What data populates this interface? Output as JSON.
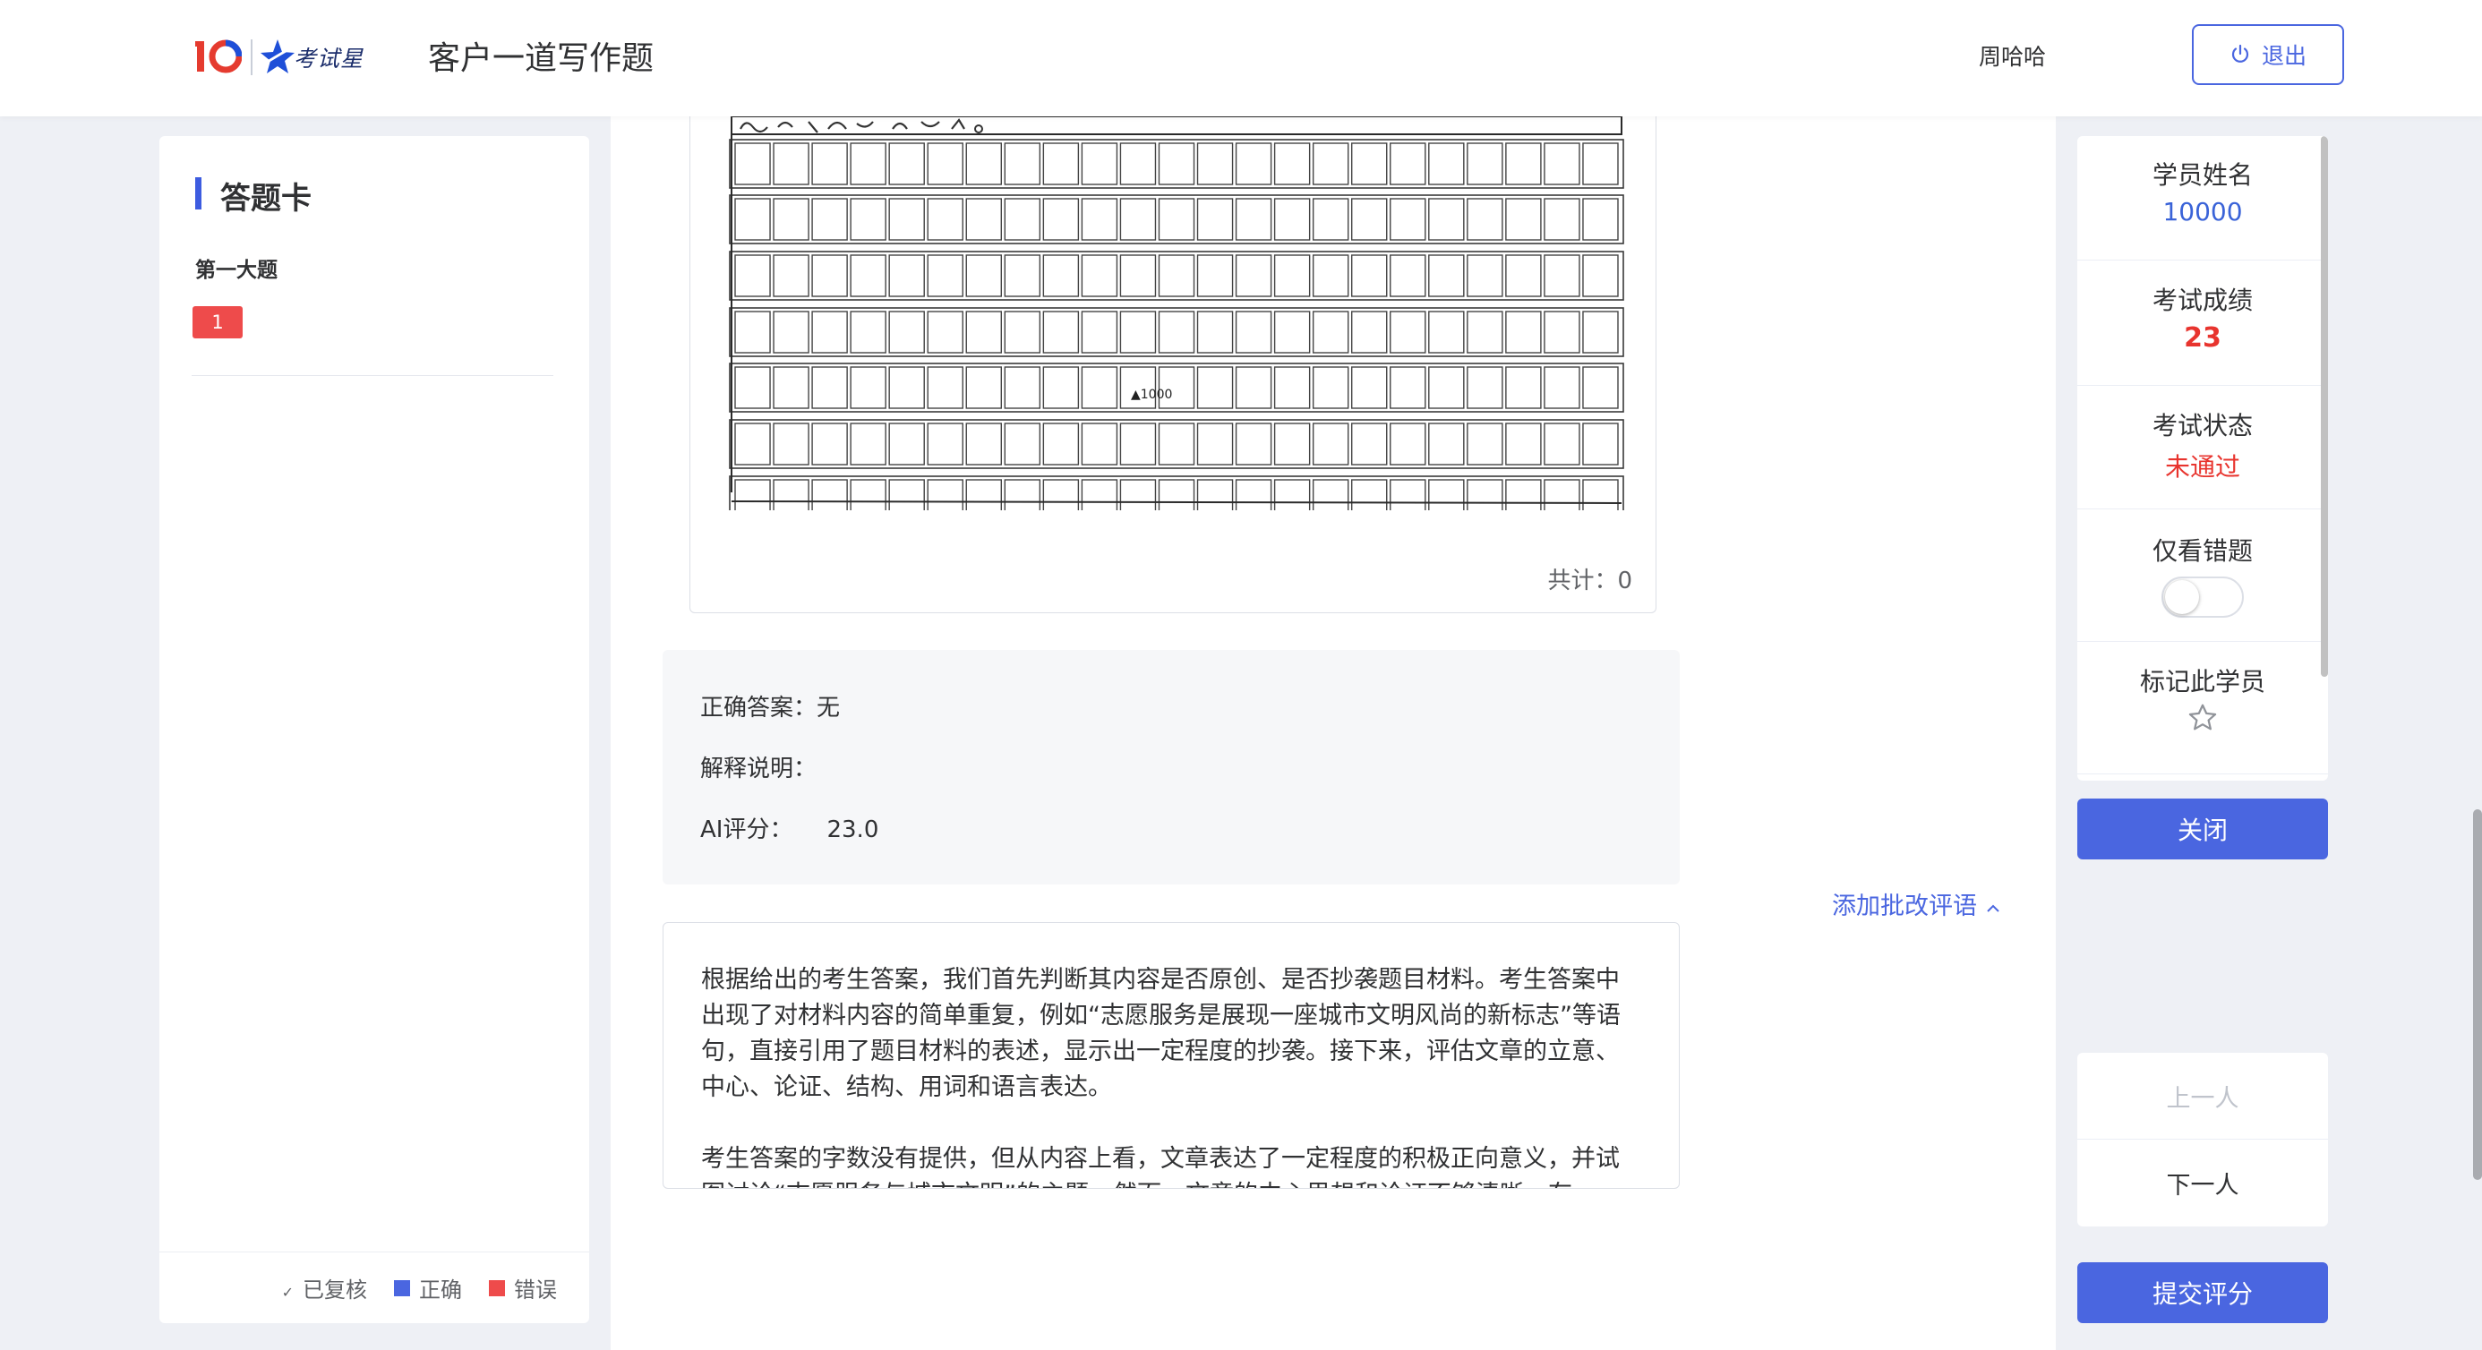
{
  "header": {
    "logo_text": "考试星",
    "title": "客户一道写作题",
    "user_name": "周哈哈",
    "logout_label": "退出"
  },
  "answer_card": {
    "title": "答题卡",
    "section_title": "第一大题",
    "questions": [
      "1"
    ],
    "legend": {
      "reviewed": "已复核",
      "correct": "正确",
      "wrong": "错误"
    }
  },
  "sheet": {
    "marker_label": "▲1000",
    "total_label": "共计：0"
  },
  "answer": {
    "correct_answer_label": "正确答案：",
    "correct_answer_value": "无",
    "explanation_label": "解释说明：",
    "ai_score_label": "AI评分：",
    "ai_score_value": "23.0"
  },
  "comment": {
    "add_label": "添加批改评语"
  },
  "ai_comment": {
    "paragraphs": [
      "根据给出的考生答案，我们首先判断其内容是否原创、是否抄袭题目材料。考生答案中出现了对材料内容的简单重复，例如“志愿服务是展现一座城市文明风尚的新标志”等语句，直接引用了题目材料的表述，显示出一定程度的抄袭。接下来，评估文章的立意、中心、论证、结构、用词和语言表达。",
      "考生答案的字数没有提供，但从内容上看，文章表达了一定程度的积极正向意义，并试图讨论“志愿服务与城市文明”的主题。然而，文章的中心思想和论证不够清晰，存"
    ]
  },
  "student": {
    "name_label": "学员姓名",
    "name_value": "10000",
    "score_label": "考试成绩",
    "score_value": "23",
    "status_label": "考试状态",
    "status_value": "未通过",
    "wrong_only_label": "仅看错题",
    "wrong_only_on": false,
    "mark_label": "标记此学员"
  },
  "actions": {
    "close_label": "关闭",
    "prev_label": "上一人",
    "next_label": "下一人",
    "submit_label": "提交评分"
  },
  "colors": {
    "accent": "#4a66e0",
    "error": "#ee4b4b",
    "status_fail": "#e8342e",
    "link_blue": "#3a63d8"
  }
}
